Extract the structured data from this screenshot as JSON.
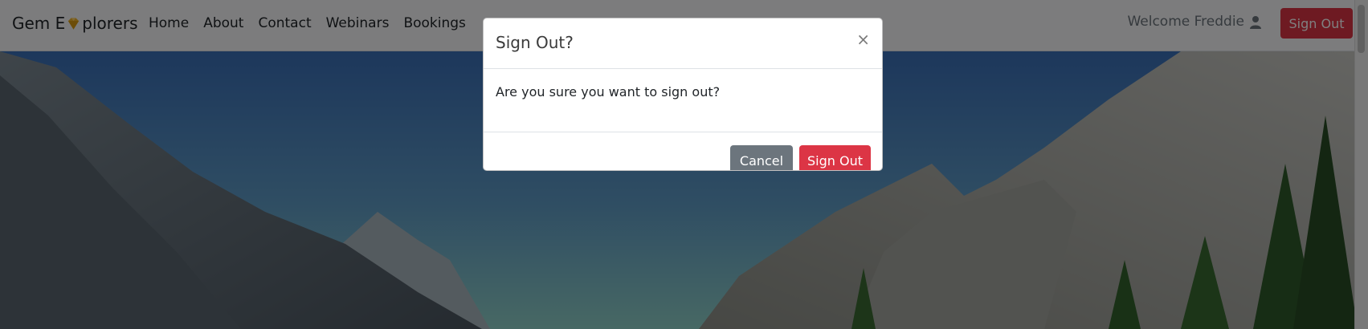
{
  "navbar": {
    "brand_prefix": "Gem E",
    "brand_suffix": "plorers",
    "brand_icon": "gem-icon",
    "links": [
      {
        "label": "Home"
      },
      {
        "label": "About"
      },
      {
        "label": "Contact"
      },
      {
        "label": "Webinars"
      },
      {
        "label": "Bookings"
      }
    ],
    "welcome_text": "Welcome Freddie",
    "user_icon": "user-icon",
    "signout_label": "Sign Out"
  },
  "modal": {
    "title": "Sign Out?",
    "close_label": "×",
    "message": "Are you sure you want to sign out?",
    "cancel_label": "Cancel",
    "confirm_label": "Sign Out"
  },
  "colors": {
    "danger": "#dc3545",
    "secondary": "#6c757d",
    "gem": "#f0b429"
  }
}
